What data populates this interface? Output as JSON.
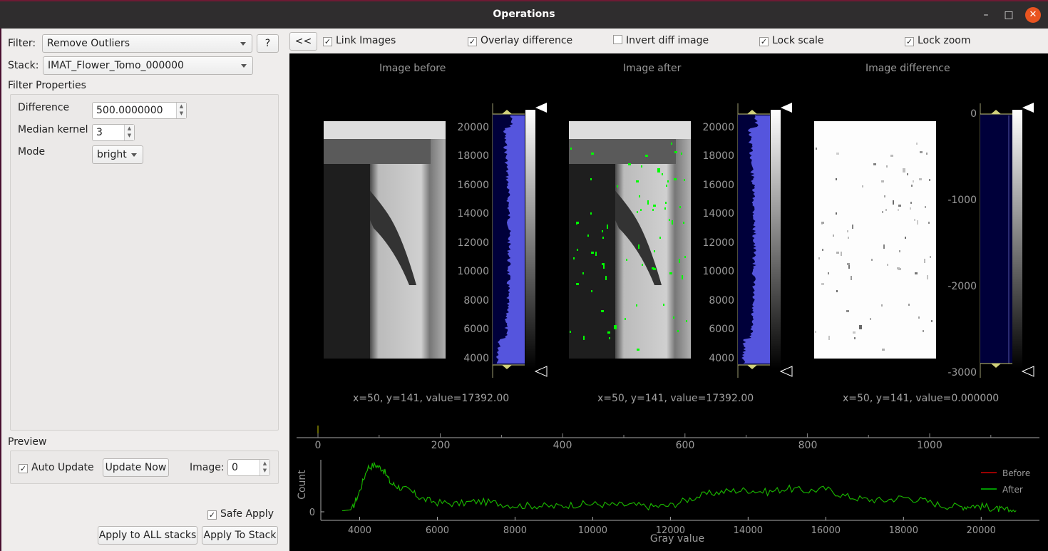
{
  "window": {
    "title": "Operations",
    "minimize": "–",
    "maximize": "□",
    "close": "✕"
  },
  "left_panel": {
    "filter_label": "Filter:",
    "filter_value": "Remove Outliers",
    "help_button": "?",
    "stack_label": "Stack:",
    "stack_value": "IMAT_Flower_Tomo_000000",
    "filter_properties_title": "Filter Properties",
    "properties": {
      "difference_label": "Difference",
      "difference_value": "500.0000000",
      "median_kernel_label": "Median kernel",
      "median_kernel_value": "3",
      "mode_label": "Mode",
      "mode_value": "bright"
    },
    "preview_title": "Preview",
    "auto_update_label": "Auto Update",
    "auto_update_checked": true,
    "update_now_button": "Update Now",
    "image_label": "Image:",
    "image_value": "0",
    "safe_apply_label": "Safe Apply",
    "safe_apply_checked": true,
    "apply_all_button": "Apply to ALL stacks",
    "apply_stack_button": "Apply To Stack"
  },
  "toolbar": {
    "collapse_button": "<<",
    "check_mark": "✓",
    "link_images": {
      "label": "Link Images",
      "checked": true
    },
    "overlay_difference": {
      "label": "Overlay difference",
      "checked": true
    },
    "invert_diff": {
      "label": "Invert diff image",
      "checked": false
    },
    "lock_scale": {
      "label": "Lock scale",
      "checked": true
    },
    "lock_zoom": {
      "label": "Lock zoom",
      "checked": true
    }
  },
  "panels": [
    {
      "title": "Image before",
      "readout": "x=50, y=141, value=17392.00",
      "hist_ticks": [
        "20000",
        "18000",
        "16000",
        "14000",
        "12000",
        "10000",
        "8000",
        "6000",
        "4000"
      ]
    },
    {
      "title": "Image after",
      "readout": "x=50, y=141, value=17392.00",
      "hist_ticks": [
        "20000",
        "18000",
        "16000",
        "14000",
        "12000",
        "10000",
        "8000",
        "6000",
        "4000"
      ]
    },
    {
      "title": "Image difference",
      "readout": "x=50, y=141, value=0.000000",
      "hist_ticks": [
        "0",
        "-1000",
        "-2000",
        "-3000"
      ]
    }
  ],
  "slider_axis": {
    "ticks": [
      "0",
      "200",
      "400",
      "600",
      "800",
      "1000"
    ]
  },
  "colors": {
    "histogram_fill": "#5555dd",
    "histogram_bg": "#00003a",
    "overlay_outlier": "#00ff00",
    "before_line": "#cc0000",
    "after_line": "#00cc00"
  },
  "chart_data": {
    "type": "line",
    "title": "",
    "xlabel": "Gray value",
    "ylabel": "Count",
    "xlim": [
      3000,
      21500
    ],
    "x_ticks": [
      "4000",
      "6000",
      "8000",
      "10000",
      "12000",
      "14000",
      "16000",
      "18000",
      "20000"
    ],
    "y_ticks": [
      "0"
    ],
    "legend": {
      "position": "top-right",
      "entries": [
        "Before",
        "After"
      ]
    },
    "series": [
      {
        "name": "Before",
        "x": [
          3550,
          3800,
          4000,
          4200,
          4400,
          4600,
          4800,
          5000,
          5300,
          5600,
          6000,
          6500,
          7000,
          7500,
          8000,
          8500,
          9000,
          9500,
          10000,
          10500,
          11000,
          11500,
          12000,
          12500,
          13000,
          13500,
          14000,
          14500,
          15000,
          15500,
          16000,
          16500,
          17000,
          17500,
          18000,
          18500,
          19000,
          19500,
          19800,
          20100,
          20400,
          20600,
          20900
        ],
        "y": [
          2,
          4,
          40,
          85,
          90,
          82,
          55,
          48,
          40,
          25,
          18,
          15,
          20,
          17,
          12,
          12,
          10,
          14,
          15,
          13,
          13,
          10,
          12,
          25,
          35,
          40,
          42,
          38,
          45,
          40,
          44,
          30,
          24,
          22,
          28,
          22,
          12,
          10,
          12,
          10,
          5,
          3,
          2
        ]
      },
      {
        "name": "After",
        "x": [
          3550,
          3800,
          4000,
          4200,
          4400,
          4600,
          4800,
          5000,
          5300,
          5600,
          6000,
          6500,
          7000,
          7500,
          8000,
          8500,
          9000,
          9500,
          10000,
          10500,
          11000,
          11500,
          12000,
          12500,
          13000,
          13500,
          14000,
          14500,
          15000,
          15500,
          16000,
          16500,
          17000,
          17500,
          18000,
          18500,
          19000,
          19500,
          19800,
          20100,
          20400,
          20600,
          20900
        ],
        "y": [
          2,
          4,
          40,
          85,
          90,
          82,
          55,
          48,
          40,
          25,
          18,
          15,
          20,
          17,
          12,
          12,
          10,
          14,
          15,
          13,
          13,
          10,
          12,
          25,
          35,
          40,
          42,
          38,
          45,
          40,
          44,
          30,
          24,
          22,
          28,
          22,
          12,
          10,
          12,
          10,
          5,
          3,
          2
        ]
      }
    ]
  }
}
